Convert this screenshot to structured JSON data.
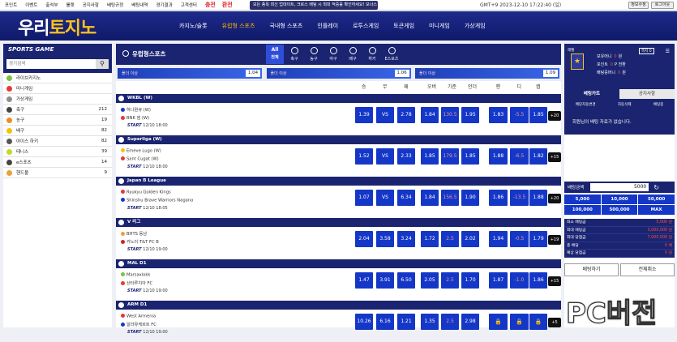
{
  "topnav": [
    "포인트",
    "이벤트",
    "출석부",
    "룰렛",
    "공지사항",
    "베팅규정",
    "베팅내역",
    "경기결과",
    "고객센터"
  ],
  "topnav_highlight": [
    "충전",
    "환전"
  ],
  "ticker": "모든 종목 최신 업데이트, 크로스 배팅 시 최대 적중률 확인하세요! 보너스 폴더 ..",
  "gmt": "GMT+9  2023-12-10 17:22:40 (일)",
  "top_buttons": {
    "info": "정보수정",
    "logout": "로그아웃"
  },
  "logo": {
    "a": "우리",
    "b": "토지노"
  },
  "nav": [
    "카지노/슬롯",
    "유럽형 스포츠",
    "국내형 스포츠",
    "인플레이",
    "로투스게임",
    "토큰게임",
    "미니게임",
    "가상게임"
  ],
  "left": {
    "title": "SPORTS GAME",
    "search_placeholder": "경기검색",
    "items": [
      {
        "name": "라이브카지노",
        "count": "",
        "color": "#7bc043"
      },
      {
        "name": "미니게임",
        "count": "",
        "color": "#e53935"
      },
      {
        "name": "가상게임",
        "count": "",
        "color": "#8e8e8e"
      },
      {
        "name": "축구",
        "count": "212",
        "color": "#444"
      },
      {
        "name": "농구",
        "count": "19",
        "color": "#f08a24"
      },
      {
        "name": "배구",
        "count": "82",
        "color": "#f4c20d"
      },
      {
        "name": "아이스 하키",
        "count": "82",
        "color": "#555"
      },
      {
        "name": "테니스",
        "count": "39",
        "color": "#c6d82a"
      },
      {
        "name": "e스포츠",
        "count": "14",
        "color": "#444"
      },
      {
        "name": "핸드볼",
        "count": "9",
        "color": "#e8a23a"
      }
    ]
  },
  "main": {
    "title": "유럽형스포츠",
    "sports": [
      {
        "label": "전체",
        "icon": "All"
      },
      {
        "label": "축구",
        "icon": ""
      },
      {
        "label": "농구",
        "icon": ""
      },
      {
        "label": "야구",
        "icon": ""
      },
      {
        "label": "배구",
        "icon": ""
      },
      {
        "label": "하키",
        "icon": ""
      },
      {
        "label": "E스포츠",
        "icon": ""
      }
    ],
    "odds_select": [
      {
        "label": "폴더 이상",
        "value": "1.04"
      },
      {
        "label": "폴더 이상",
        "value": "1.06"
      },
      {
        "label": "폴더 이상",
        "value": "1.09"
      }
    ],
    "columns": [
      "승",
      "무",
      "패",
      "오버",
      "기준",
      "언더",
      "핸",
      "디",
      "캡"
    ],
    "leagues": [
      {
        "name": "WKBL (W)",
        "home": "하나원큐 (W)",
        "away": "BNK 썸 (W)",
        "start": "12/10 18:00",
        "odds": [
          "1.39",
          "VS",
          "2.78",
          "1.84",
          "130.5",
          "1.95",
          "1.83",
          "-5.5",
          "1.85"
        ],
        "plus": "+20",
        "hcolor": "#1537c8",
        "acolor": "#e53935"
      },
      {
        "name": "Superliga (W)",
        "home": "Emeve Lugo (W)",
        "away": "Sant Cugat (W)",
        "start": "12/10 18:00",
        "odds": [
          "1.52",
          "VS",
          "2.33",
          "1.85",
          "179.5",
          "1.85",
          "1.88",
          "-6.5",
          "1.82"
        ],
        "plus": "+15",
        "hcolor": "#f4c20d",
        "acolor": "#e53935"
      },
      {
        "name": "Japan B League",
        "home": "Ryukyu Golden Kings",
        "away": "Shinshu Brave Warriors Nagano",
        "start": "12/10 18:05",
        "odds": [
          "1.07",
          "VS",
          "6.34",
          "1.84",
          "156.5",
          "1.90",
          "1.86",
          "-13.5",
          "1.88"
        ],
        "plus": "+20",
        "hcolor": "#e53935",
        "acolor": "#1537c8"
      },
      {
        "name": "V 리그",
        "home": "BHTS 동남",
        "away": "카노이 T&T FC B",
        "start": "12/10 19:00",
        "odds": [
          "2.04",
          "3.58",
          "3.24",
          "1.72",
          "2.5",
          "2.02",
          "1.94",
          "-0.5",
          "1.79"
        ],
        "plus": "+19",
        "hcolor": "#e8a23a",
        "acolor": "#c62828"
      },
      {
        "name": "MAL D1",
        "home": "Marsaxlokk",
        "away": "산타루치아 FC",
        "start": "12/10 19:00",
        "odds": [
          "1.47",
          "3.91",
          "6.50",
          "2.05",
          "2.5",
          "1.70",
          "1.87",
          "-1.0",
          "1.86"
        ],
        "plus": "+15",
        "hcolor": "#7bc043",
        "acolor": "#e53935"
      },
      {
        "name": "ARM D1",
        "home": "West Armenia",
        "away": "알라뮤케르트 FC",
        "start": "12/10 19:00",
        "odds": [
          "10.26",
          "6.16",
          "1.21",
          "1.35",
          "2.5",
          "2.98",
          "",
          "",
          ""
        ],
        "plus": "+5",
        "hcolor": "#e53935",
        "acolor": "#1537c8"
      }
    ]
  },
  "right": {
    "level": "레벨",
    "messages": "쪽지 0",
    "lines": [
      {
        "label": "보유머니",
        "value": "0",
        "unit": "원"
      },
      {
        "label": "포인트",
        "value": "0",
        "unit": "P 전환"
      },
      {
        "label": "배팅중머니",
        "value": "0",
        "unit": "원"
      }
    ],
    "tabs": [
      "베팅카트",
      "공지사항"
    ],
    "options": [
      "배당자동변경",
      "자동삭제",
      "배팅중"
    ],
    "nobet": "회원님의 배팅 자료가 없습니다.",
    "amount_label": "배팅금액",
    "amount_value": "5000",
    "chips": [
      "5,000",
      "10,000",
      "50,000",
      "100,000",
      "500,000",
      "MAX"
    ],
    "limits": [
      {
        "k": "최소 베팅금",
        "v": "5,000 원"
      },
      {
        "k": "최대 베팅금",
        "v": "3,000,000 원"
      },
      {
        "k": "최대 당첨금",
        "v": "7,000,000 원"
      },
      {
        "k": "총 배당",
        "v": "0 배"
      },
      {
        "k": "예상 당첨금",
        "v": "0 원"
      }
    ],
    "bet_button": "베팅하기",
    "cancel_button": "전체취소"
  },
  "watermark": "PC버전"
}
